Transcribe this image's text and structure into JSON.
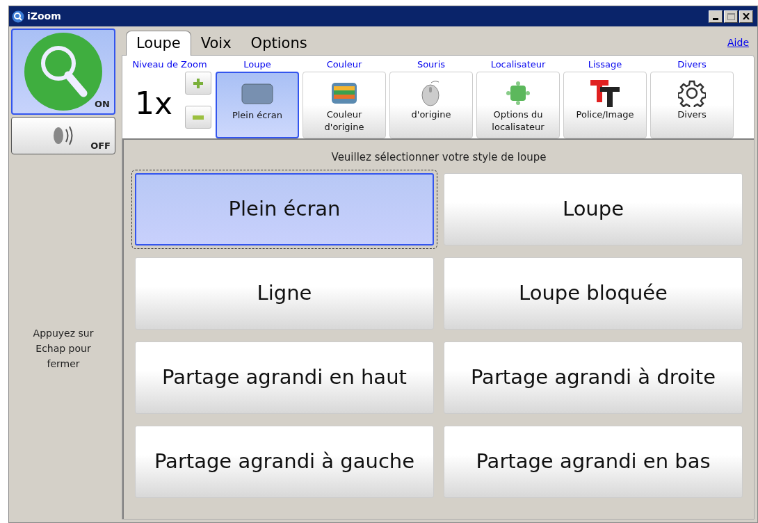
{
  "window": {
    "title": "iZoom"
  },
  "side": {
    "magnifier": {
      "label": "ON",
      "on": true
    },
    "speech": {
      "label": "OFF",
      "on": false
    },
    "hint": "Appuyez sur Echap pour fermer"
  },
  "tabs": [
    {
      "label": "Loupe",
      "selected": true
    },
    {
      "label": "Voix",
      "selected": false
    },
    {
      "label": "Options",
      "selected": false
    }
  ],
  "help_link": "Aide",
  "toolbar": [
    {
      "kind": "zoom",
      "heading": "Niveau de Zoom",
      "value": "1x"
    },
    {
      "kind": "tool",
      "heading": "Loupe",
      "label": "Plein écran",
      "selected": true
    },
    {
      "kind": "tool",
      "heading": "Couleur",
      "label": "Couleur d'origine",
      "selected": false
    },
    {
      "kind": "tool",
      "heading": "Souris",
      "label": "d'origine",
      "selected": false
    },
    {
      "kind": "tool",
      "heading": "Localisateur",
      "label": "Options du localisateur",
      "selected": false
    },
    {
      "kind": "tool",
      "heading": "Lissage",
      "label": "Police/Image",
      "selected": false
    },
    {
      "kind": "tool",
      "heading": "Divers",
      "label": "Divers",
      "selected": false
    }
  ],
  "prompt": "Veuillez sélectionner votre style de loupe",
  "styles": [
    {
      "label": "Plein écran",
      "selected": true
    },
    {
      "label": "Loupe",
      "selected": false
    },
    {
      "label": "Ligne",
      "selected": false
    },
    {
      "label": "Loupe bloquée",
      "selected": false
    },
    {
      "label": "Partage agrandi en haut",
      "selected": false
    },
    {
      "label": "Partage agrandi à droite",
      "selected": false
    },
    {
      "label": "Partage agrandi à gauche",
      "selected": false
    },
    {
      "label": "Partage agrandi en bas",
      "selected": false
    }
  ]
}
